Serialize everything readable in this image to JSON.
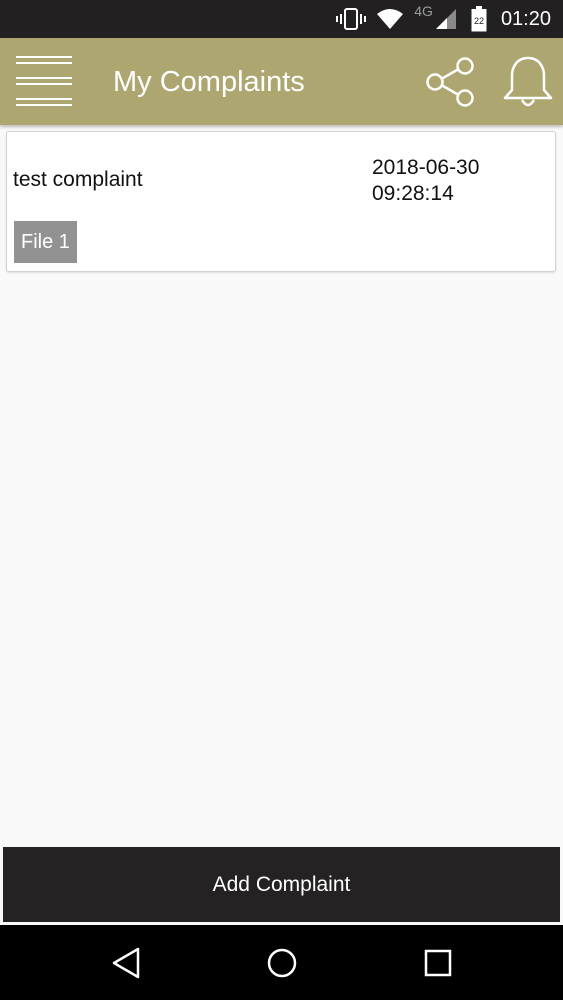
{
  "status_bar": {
    "network_type": "4G",
    "battery_level": "22",
    "time": "01:20",
    "icons": [
      "vibrate-icon",
      "wifi-icon",
      "cell-signal-icon",
      "battery-icon"
    ]
  },
  "app_bar": {
    "title": "My Complaints",
    "icons": [
      "menu-icon",
      "share-icon",
      "bell-icon"
    ],
    "background_color": "#aea671"
  },
  "complaints": [
    {
      "title": "test complaint",
      "date": "2018-06-30",
      "time": "09:28:14",
      "attachment_label": "File 1"
    }
  ],
  "add_button": {
    "label": "Add Complaint"
  },
  "nav_bar": {
    "icons": [
      "back-icon",
      "home-icon",
      "recents-icon"
    ]
  }
}
